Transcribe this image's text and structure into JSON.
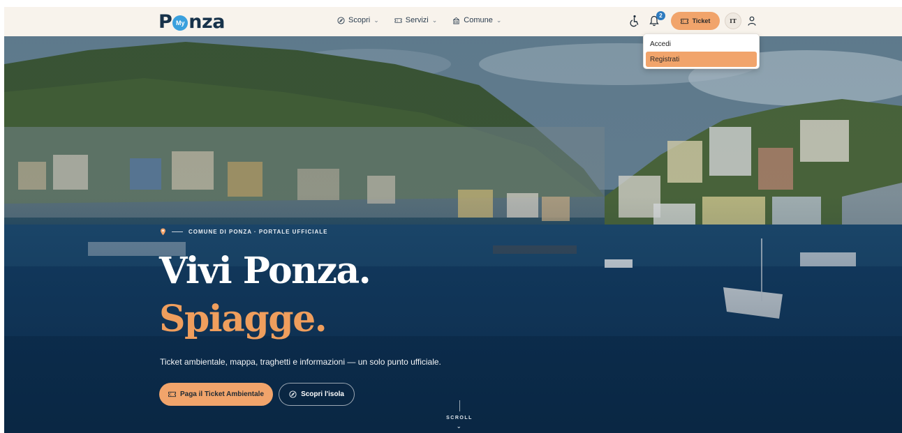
{
  "brand": {
    "logo_first": "P",
    "logo_badge": "My",
    "logo_rest": "nza"
  },
  "nav": {
    "links": [
      {
        "label": "Scopri",
        "icon": "compass-icon"
      },
      {
        "label": "Servizi",
        "icon": "ticket-icon"
      },
      {
        "label": "Comune",
        "icon": "building-icon"
      }
    ],
    "notifications_count": "2",
    "ticket_label": "Ticket",
    "language": "IT"
  },
  "user_menu": {
    "items": [
      {
        "label": "Accedi",
        "active": false
      },
      {
        "label": "Registrati",
        "active": true
      }
    ]
  },
  "hero": {
    "eyebrow": "COMUNE DI PONZA · PORTALE UFFICIALE",
    "title_line1": "Vivi Ponza.",
    "title_line2": "Spiagge.",
    "subtitle": "Ticket ambientale, mappa, traghetti e informazioni — un solo punto ufficiale.",
    "cta_primary": "Paga il Ticket Ambientale",
    "cta_secondary": "Scopri l'isola",
    "scroll_label": "SCROLL"
  },
  "colors": {
    "accent": "#f1a46b",
    "title_accent": "#ef9e5d",
    "navbar_bg": "#f8f3ec",
    "badge": "#2e7bbf",
    "brand_dark": "#17324a",
    "logo_blue": "#3aa0dd"
  }
}
